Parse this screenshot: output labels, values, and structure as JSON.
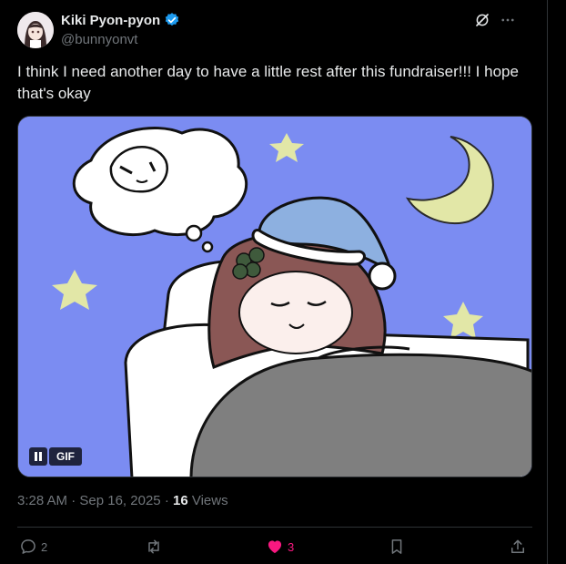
{
  "author": {
    "display_name": "Kiki Pyon-pyon",
    "handle": "@bunnyonvt",
    "verified": true
  },
  "tweet": {
    "text": "I think I need another day to have a little rest after this fundraiser!!! I hope that's okay"
  },
  "media": {
    "type": "gif",
    "badge": "GIF",
    "background_color": "#7b8cf2"
  },
  "meta": {
    "time": "3:28 AM",
    "separator": "·",
    "date": "Sep 16, 2025",
    "views_count": "16",
    "views_label": "Views"
  },
  "actions": {
    "replies": "2",
    "reposts": "",
    "likes": "3",
    "liked": true
  },
  "colors": {
    "background": "#000000",
    "text": "#e7e9ea",
    "secondary": "#71767b",
    "like": "#f91880",
    "verified": "#1d9bf0"
  }
}
